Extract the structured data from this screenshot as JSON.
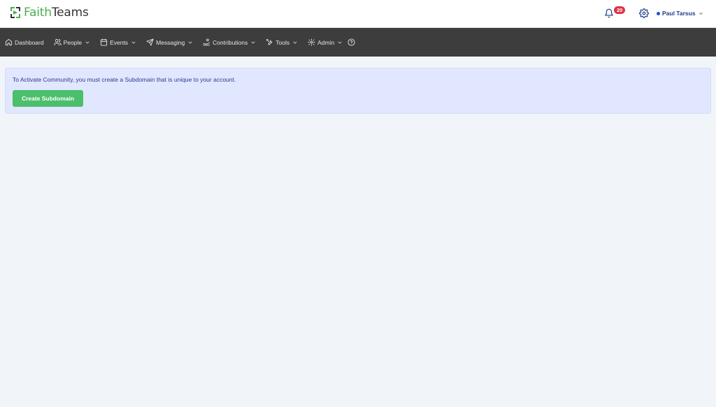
{
  "header": {
    "logo_part1": "Faith",
    "logo_part2": "Teams",
    "logo_color_primary": "#4caf50",
    "logo_color_secondary": "#333333",
    "notifications_count": "20",
    "user_name": "Paul Tarsus",
    "icons": [
      "bell-icon",
      "gear-icon",
      "chevron-down-icon"
    ]
  },
  "nav": {
    "dashboard": "Dashboard",
    "people": "People",
    "events": "Events",
    "messaging": "Messaging",
    "contributions": "Contributions",
    "tools": "Tools",
    "admin": "Admin",
    "icons": [
      "home-icon",
      "users-icon",
      "calendar-icon",
      "paper-plane-icon",
      "hand-coin-icon",
      "tools-icon",
      "gear-icon",
      "help-circle-icon"
    ]
  },
  "alert": {
    "message": "To Activate Community, you must create a Subdomain that is unique to your account.",
    "button_label": "Create Subdomain",
    "background_color": "#e0e7ff",
    "button_color": "#4bbf6b"
  }
}
